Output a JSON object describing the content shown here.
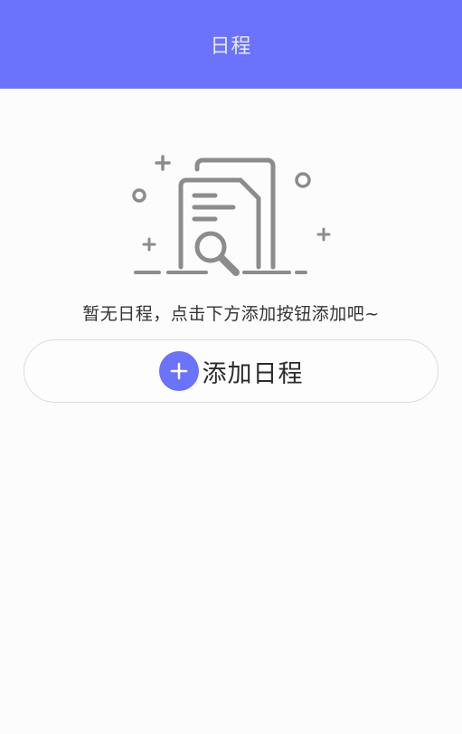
{
  "header": {
    "title": "日程",
    "background_color": "#6b72fb"
  },
  "empty_state": {
    "illustration_icon": "empty-document-search-icon",
    "message": "暂无日程，点击下方添加按钮添加吧~"
  },
  "add_button": {
    "icon": "plus-icon",
    "label": "添加日程",
    "accent_color": "#6b72fb"
  }
}
